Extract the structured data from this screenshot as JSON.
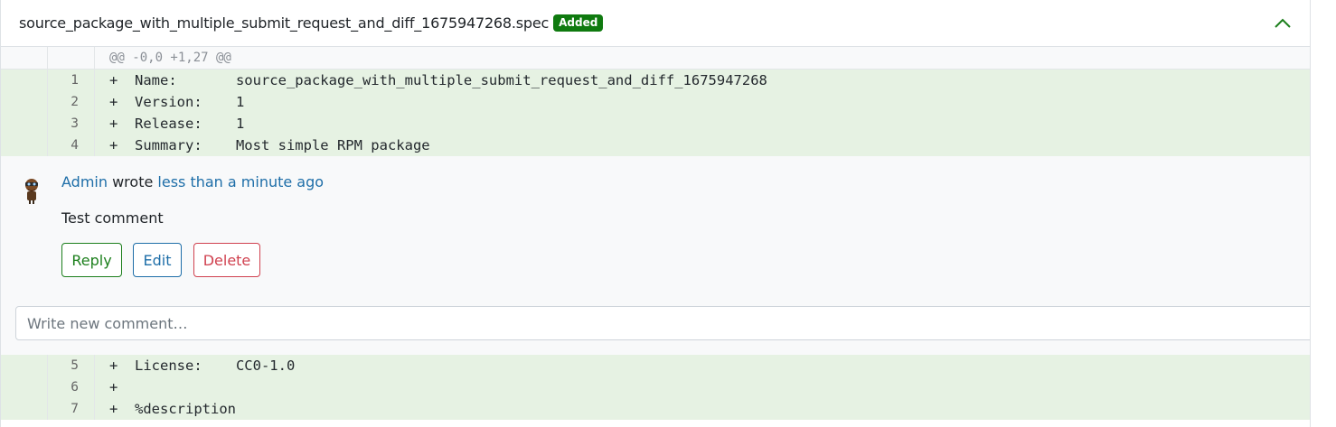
{
  "file": {
    "name": "source_package_with_multiple_submit_request_and_diff_1675947268.spec",
    "badge": "Added"
  },
  "hunk_header": "@@ -0,0 +1,27 @@",
  "lines_before": [
    {
      "num": "1",
      "text": "+  Name:       source_package_with_multiple_submit_request_and_diff_1675947268"
    },
    {
      "num": "2",
      "text": "+  Version:    1"
    },
    {
      "num": "3",
      "text": "+  Release:    1"
    },
    {
      "num": "4",
      "text": "+  Summary:    Most simple RPM package"
    }
  ],
  "comment": {
    "author": "Admin",
    "verb": "wrote",
    "time": "less than a minute ago",
    "body": "Test comment",
    "reply_label": "Reply",
    "edit_label": "Edit",
    "delete_label": "Delete",
    "new_comment_placeholder": "Write new comment…"
  },
  "lines_after": [
    {
      "num": "5",
      "text": "+  License:    CC0-1.0"
    },
    {
      "num": "6",
      "text": "+"
    },
    {
      "num": "7",
      "text": "+  %description"
    }
  ],
  "colors": {
    "added_bg": "#e6f2e3",
    "badge_bg": "#0f7a0f",
    "link": "#1e6ea8",
    "reply": "#1c7f1c",
    "delete": "#d0414f"
  },
  "icons": {
    "collapse": "chevron-up-icon",
    "avatar": "avatar"
  }
}
